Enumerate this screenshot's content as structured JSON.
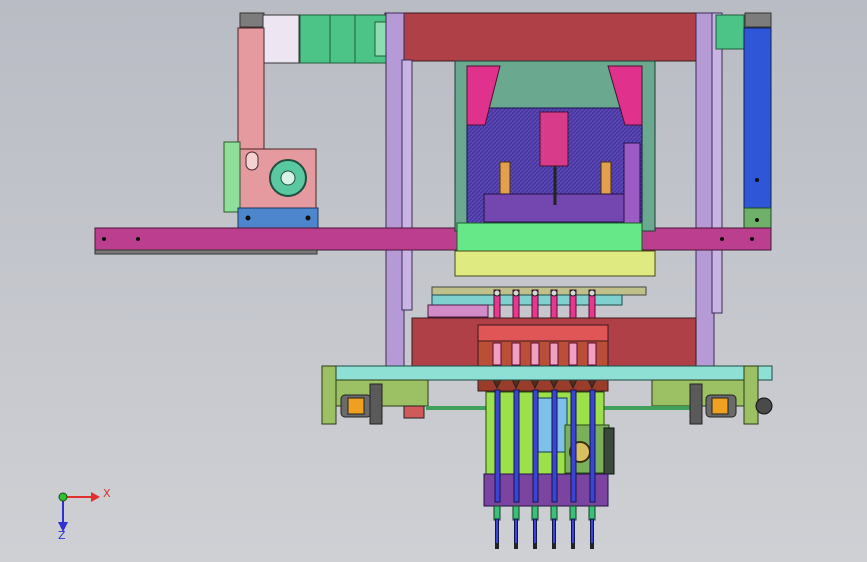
{
  "axes": {
    "x_label": "X",
    "z_label": "Z"
  },
  "palette": {
    "background": "#c3c5cb",
    "frame_purple": "#b69ad6",
    "top_beam_red": "#b04048",
    "long_bar_magenta": "#bb3f8e",
    "motor_green": "#4cc487",
    "gearbox_pink": "#e49a9f",
    "blue_plate": "#4d86cc",
    "die_navy": "#4a38a0",
    "die_green": "#66e888",
    "die_yellow": "#dfeb80",
    "needle_pink": "#e8378f",
    "manifold_brown": "#bb4e36",
    "base_teal": "#8fe0d4",
    "base_olive": "#9cc064",
    "rod_blue": "#3c44d6",
    "right_column_blue": "#2f56d6"
  },
  "tools": {
    "count": 6
  }
}
